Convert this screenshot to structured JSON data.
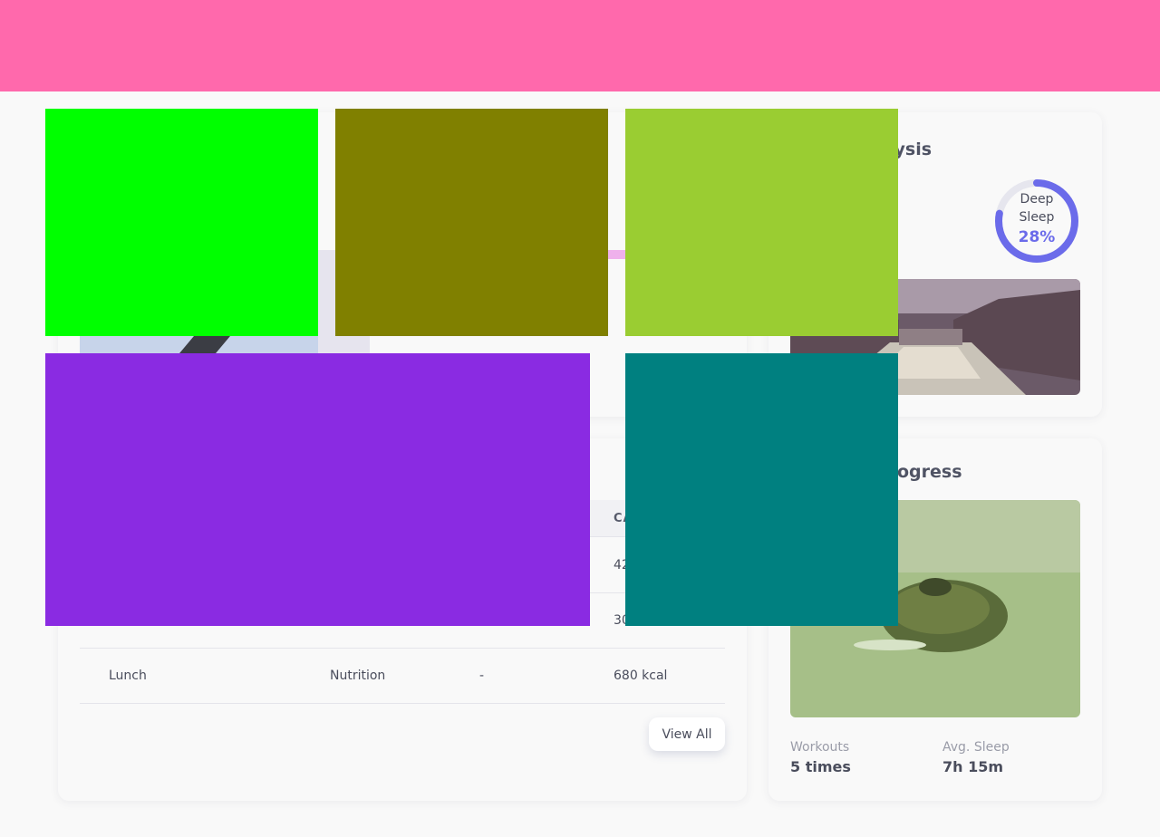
{
  "header": {
    "color": "#ff69ac"
  },
  "sleep": {
    "title_visible": "lysis",
    "ring_label": "Deep Sleep",
    "ring_value": "28%",
    "ring_fraction": 0.28,
    "ring_color": "#6b6bea"
  },
  "progress": {
    "title_visible": "ogress",
    "stats": [
      {
        "label": "Workouts",
        "value": "5 times"
      },
      {
        "label": "Avg. Sleep",
        "value": "7h 15m"
      }
    ]
  },
  "activity": {
    "header_partial": "CA",
    "rows": [
      {
        "col1": "",
        "col2": "",
        "col3": "",
        "col4": "42"
      },
      {
        "col1": "",
        "col2": "",
        "col3": "",
        "col4": "30"
      },
      {
        "col1": "Lunch",
        "col2": "Nutrition",
        "col3": "-",
        "col4": "680 kcal"
      }
    ],
    "view_all_label": "View All"
  },
  "overlay_colors": {
    "green": "#00ff00",
    "olive": "#808000",
    "yellowgreen": "#9acd32",
    "purple": "#8a2be2",
    "teal": "#008080"
  },
  "icons": [
    "sleep-ring-icon"
  ]
}
